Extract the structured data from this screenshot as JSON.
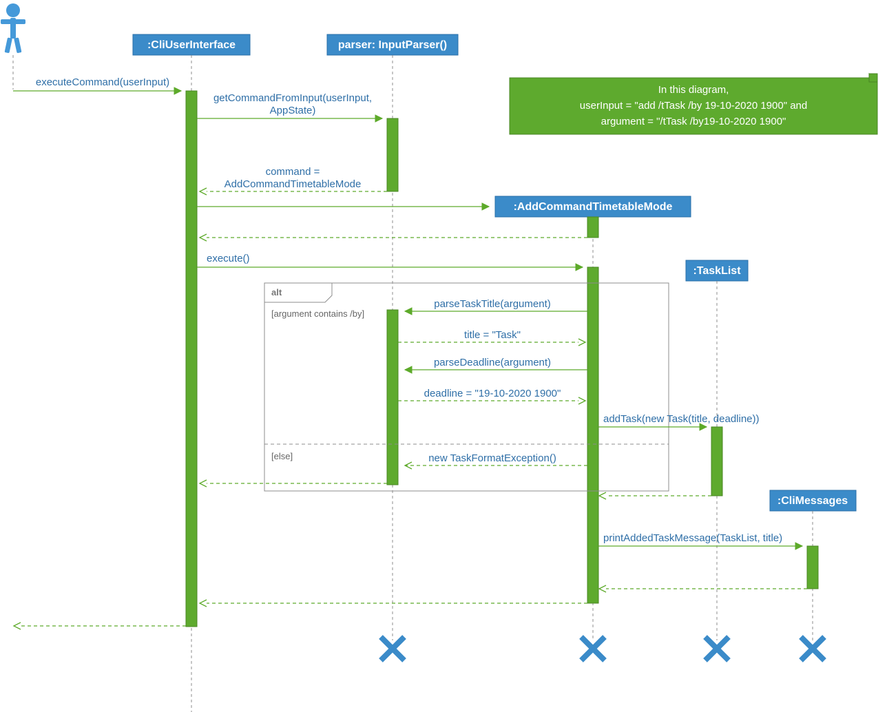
{
  "lifelines": {
    "actor": {
      "type": "actor"
    },
    "cli": {
      "label": ":CliUserInterface"
    },
    "parser": {
      "label": "parser: InputParser()"
    },
    "addcmd": {
      "label": ":AddCommandTimetableMode"
    },
    "tasklist": {
      "label": ":TaskList"
    },
    "climsg": {
      "label": ":CliMessages"
    }
  },
  "note": {
    "line1": "In this diagram,",
    "line2": "userInput = \"add /tTask /by 19-10-2020 1900\" and",
    "line3": "argument = \"/tTask /by19-10-2020 1900\""
  },
  "fragment": {
    "label": "alt",
    "guard1": "[argument contains /by]",
    "guard2": "[else]"
  },
  "messages": {
    "m1": "executeCommand(userInput)",
    "m2a": "getCommandFromInput(userInput,",
    "m2b": "AppState)",
    "m3a": "command =",
    "m3b": "AddCommandTimetableMode",
    "m4": "execute()",
    "m5": "parseTaskTitle(argument)",
    "m6": "title = \"Task\"",
    "m7": "parseDeadline(argument)",
    "m8": "deadline = \"19-10-2020 1900\"",
    "m9": "addTask(new Task(title, deadline))",
    "m10": "new TaskFormatException()",
    "m11": "printAddedTaskMessage(TaskList, title)"
  }
}
